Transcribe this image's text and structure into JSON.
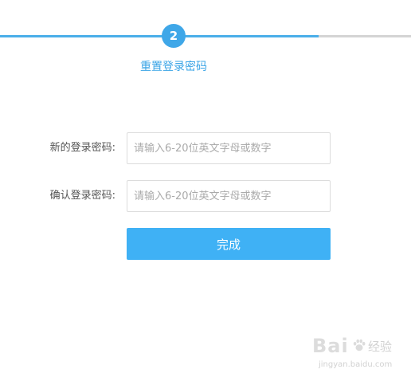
{
  "progress": {
    "step_number": "2",
    "step_label": "重置登录密码",
    "fill_fraction": 0.775,
    "fill_color": "#4aaee9",
    "track_color": "#d4d4d4"
  },
  "form": {
    "new_password": {
      "label": "新的登录密码:",
      "placeholder": "请输入6-20位英文字母或数字",
      "value": ""
    },
    "confirm_password": {
      "label": "确认登录密码:",
      "placeholder": "请输入6-20位英文字母或数字",
      "value": ""
    },
    "submit_label": "完成",
    "accent_color": "#3fb1f5"
  },
  "watermark": {
    "brand": "Bai",
    "brand_suffix": "经验",
    "url": "jingyan.baidu.com",
    "icon": "paw-icon"
  }
}
